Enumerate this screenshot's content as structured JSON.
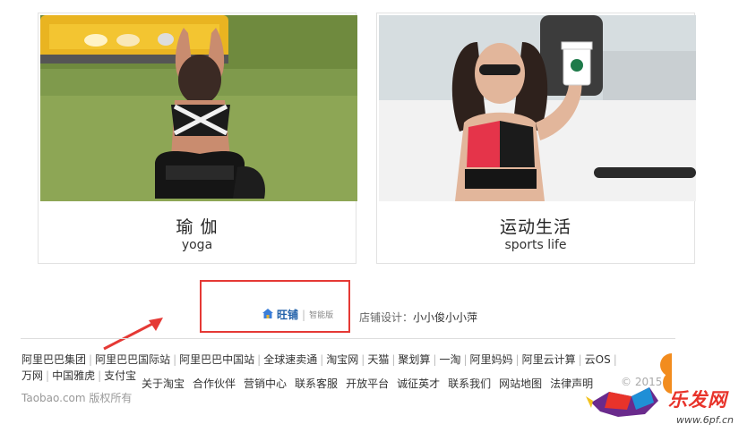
{
  "cards": [
    {
      "title": "瑜 伽",
      "subtitle": "yoga",
      "photo_icon": "yoga-photo"
    },
    {
      "title": "运动生活",
      "subtitle": "sports life",
      "photo_icon": "sports-life-photo"
    }
  ],
  "wangpu": {
    "name": "旺铺",
    "version": "智能版",
    "icon": "house-icon"
  },
  "designer": {
    "label": "店铺设计：",
    "name": "小小俊小小萍"
  },
  "footer": {
    "row1": [
      "阿里巴巴集团",
      "阿里巴巴国际站",
      "阿里巴巴中国站",
      "全球速卖通",
      "淘宝网",
      "天猫",
      "聚划算",
      "一淘",
      "阿里妈妈",
      "阿里云计算",
      "云OS"
    ],
    "row2": [
      "万网",
      "中国雅虎",
      "支付宝"
    ],
    "row3": [
      "关于淘宝",
      "合作伙伴",
      "营销中心",
      "联系客服",
      "开放平台",
      "诚征英才",
      "联系我们",
      "网站地图",
      "法律声明"
    ],
    "copyright": "Taobao.com 版权所有",
    "year": "© 2015"
  },
  "watermark": {
    "brand": "乐发网",
    "url": "www.6pf.cn"
  },
  "colors": {
    "annotation_red": "#e53935",
    "brand_red": "#e8332a"
  }
}
